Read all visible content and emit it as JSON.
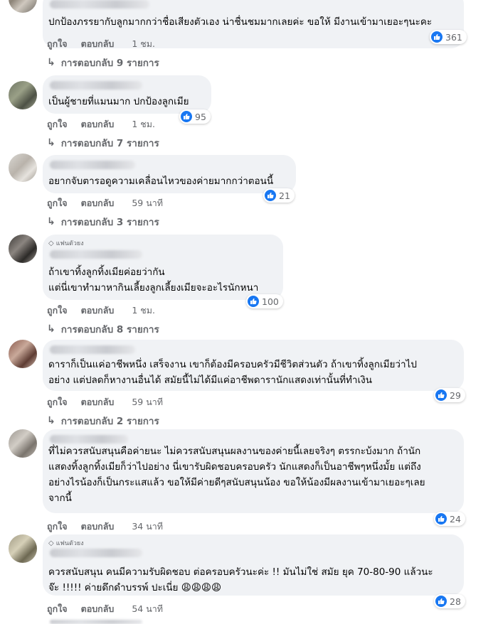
{
  "labels": {
    "like": "ถูกใจ",
    "reply": "ตอบกลับ",
    "fan_badge": "แฟนตัวยง"
  },
  "comments": [
    {
      "text": "ปกป้องภรรยากับลูกมากกว่าชื่อเสียงตัวเอง น่าชื่นชมมากเลยค่ะ ขอให้ มีงานเข้ามาเยอะๆนะคะ",
      "reactions": "361",
      "time": "1 ชม.",
      "replies": "การตอบกลับ 9 รายการ"
    },
    {
      "text": "เป็นผู้ชายที่แมนมาก ปกป้องลูกเมีย",
      "reactions": "95",
      "time": "1 ชม.",
      "replies": "การตอบกลับ 7 รายการ"
    },
    {
      "text": "อยากจับตารอดูความเคลื่อนไหวของค่ายมากกว่าตอนนี้",
      "reactions": "21",
      "time": "59 นาที",
      "replies": "การตอบกลับ 3 รายการ"
    },
    {
      "text": "ถ้าเขาทิ้งลูกทิ้งเมียค่อยว่ากัน\nแต่นี่เขาทำมาหากินเลี้ยงลูกเลี้ยงเมียจะอะไรนักหนา",
      "reactions": "100",
      "time": "1 ชม.",
      "replies": "การตอบกลับ 8 รายการ"
    },
    {
      "text": "ดาราก็เป็นแค่อาชีพหนึ่ง เสร็จงาน เขาก็ต้องมีครอบครัวมีชีวิตส่วนตัว ถ้าเขาทิ้งลูกเมียว่าไป\nอย่าง แต่ปลดก็หางานอื่นได้ สมัยนี้ไม่ได้มีแค่อาชีพดารานักแสดงเท่านั้นที่ทำเงิน",
      "reactions": "29",
      "time": "59 นาที",
      "replies": "การตอบกลับ 2 รายการ"
    },
    {
      "text": "ที่ไม่ควรสนับสนุนคือค่ายนะ ไม่ควรสนับสนุนผลงานของค่ายนี้เลยจริงๆ ตรรกะบ้งมาก ถ้านัก\nแสดงทิ้งลูกทิ้งเมียก็ว่าไปอย่าง นี่เขารับผิดชอบครอบครัว นักแสดงก็เป็นอาชีพๆหนึ่งมั้ย แต่ถึง\nอย่างไรน้องก็เป็นกระแสแล้ว ขอให้มีค่ายดีๆสนับสนุนน้อง ขอให้น้องมีผลงานเข้ามาเยอะๆเลย\nจากนี้",
      "reactions": "24",
      "time": "34 นาที"
    },
    {
      "text": "ควรสนับสนุน คนมีความรับผิดชอบ ต่อครอบครัวนะค่ะ !! มันไม่ใช่ สมัย ยุค 70-80-90 แล้วนะ\nจ๊ะ !!!!! ค่ายดึกดำบรรพ์ ปะเนี่ย 😩😩😩😩",
      "reactions": "28",
      "time": "54 นาที"
    }
  ]
}
